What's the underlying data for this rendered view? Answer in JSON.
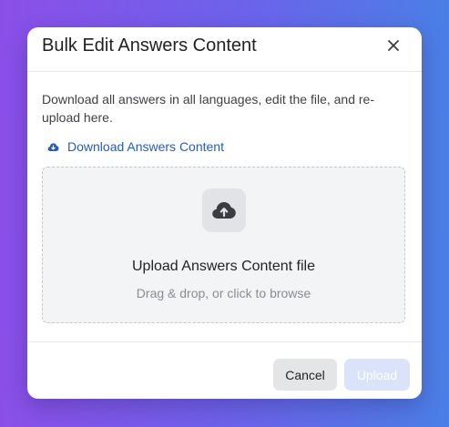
{
  "modal": {
    "title": "Bulk Edit Answers Content",
    "close_icon": "close-icon"
  },
  "body": {
    "description": "Download all answers in all languages, edit the file, and re-upload here.",
    "download_link": {
      "label": "Download Answers Content",
      "icon": "cloud-download-icon"
    },
    "dropzone": {
      "icon": "cloud-upload-icon",
      "title": "Upload Answers Content file",
      "hint": "Drag & drop, or click to browse"
    }
  },
  "footer": {
    "cancel_label": "Cancel",
    "upload_label": "Upload",
    "upload_disabled": true
  },
  "colors": {
    "link": "#1f5cc9",
    "upload_disabled_bg": "#dbe3fb",
    "cancel_bg": "#e4e5e7"
  }
}
